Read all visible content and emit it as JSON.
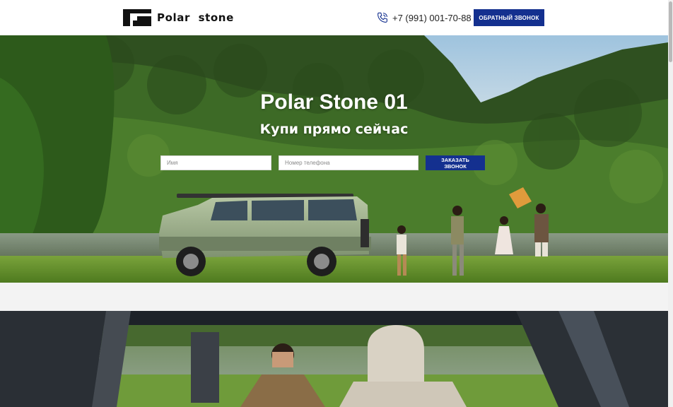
{
  "header": {
    "logo_text": "Polar  stone",
    "phone": "+7 (991) 001-70-88",
    "callback_label": "ОБРАТНЫЙ ЗВОНОК"
  },
  "hero": {
    "title": "Polar Stone 01",
    "subtitle": "Купи прямо сейчас",
    "name_placeholder": "Имя",
    "phone_placeholder": "Номер телефона",
    "order_label": "ЗАКАЗАТЬ ЗВОНОК"
  },
  "icons": {
    "logo": "polar-stone-logo-mark",
    "phone": "phone-icon"
  },
  "colors": {
    "accent": "#14308f",
    "header_bg": "#ffffff",
    "band_bg": "#f3f3f3"
  }
}
